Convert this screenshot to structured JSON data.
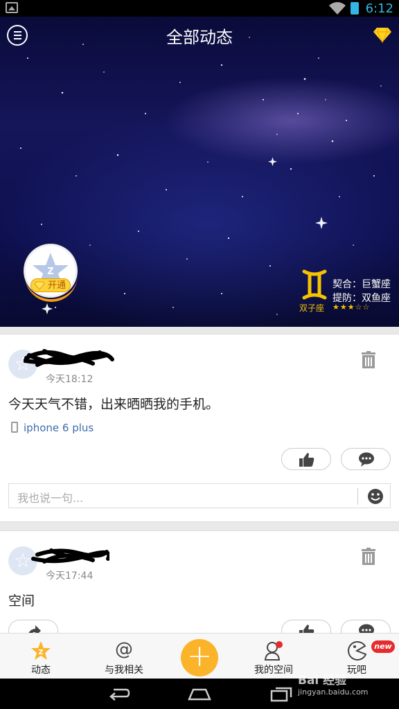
{
  "status_bar": {
    "time": "6:12"
  },
  "header": {
    "title": "全部动态",
    "vip_badge_label": "开通"
  },
  "zodiac": {
    "sign": "双子座",
    "match": "契合：巨蟹座",
    "beware": "提防：双鱼座",
    "rating": 3,
    "rating_max": 5,
    "rating_stars": "★★★☆☆"
  },
  "posts": [
    {
      "time": "今天18:12",
      "text": "今天天气不错，出来晒晒我的手机。",
      "device": "iphone 6 plus",
      "comment_placeholder": "我也说一句..."
    },
    {
      "time": "今天17:44",
      "text": "空间"
    }
  ],
  "tabs": [
    {
      "label": "动态",
      "icon": "star-z-icon",
      "active": true
    },
    {
      "label": "与我相关",
      "icon": "at-icon"
    },
    {
      "label": "",
      "icon": "plus-icon"
    },
    {
      "label": "我的空间",
      "icon": "user-icon"
    },
    {
      "label": "玩吧",
      "icon": "pacman-icon",
      "badge": "new"
    }
  ],
  "watermark": {
    "brand": "Bai 经验",
    "url": "jingyan.baidu.com"
  },
  "colors": {
    "accent": "#fbb42a",
    "link": "#3d6cac",
    "status": "#33b5e5"
  }
}
